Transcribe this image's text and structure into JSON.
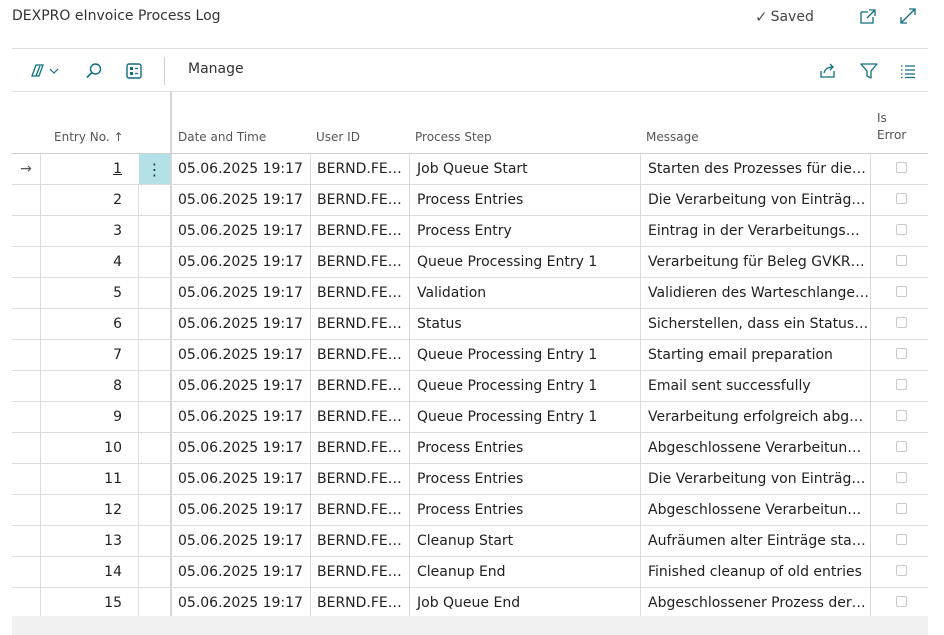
{
  "window": {
    "title": "DEXPRO eInvoice Process Log",
    "saved_label": "Saved",
    "icons": [
      "open-in-new-window-icon",
      "expand-icon"
    ]
  },
  "actionbar": {
    "icons_left": [
      "copilot-icon",
      "chevron-down-icon",
      "search-icon",
      "edit-list-icon"
    ],
    "manage_label": "Manage",
    "icons_right": [
      "share-icon",
      "filter-icon",
      "list-view-icon"
    ]
  },
  "columns": {
    "entry_no": "Entry No.",
    "sort_indicator": "↑",
    "date_time": "Date and Time",
    "user_id": "User ID",
    "process_step": "Process Step",
    "message": "Message",
    "is_error_1": "Is",
    "is_error_2": "Error"
  },
  "rows": [
    {
      "entry": "1",
      "date": "05.06.2025 19:17",
      "user": "BERND.FED...",
      "step": "Job Queue Start",
      "message": "Starten des Prozesses für die e..."
    },
    {
      "entry": "2",
      "date": "05.06.2025 19:17",
      "user": "BERND.FED...",
      "step": "Process Entries",
      "message": "Die Verarbeitung von Einträge..."
    },
    {
      "entry": "3",
      "date": "05.06.2025 19:17",
      "user": "BERND.FED...",
      "step": "Process Entry",
      "message": "Eintrag in der Verarbeitungswa..."
    },
    {
      "entry": "4",
      "date": "05.06.2025 19:17",
      "user": "BERND.FED...",
      "step": "Queue Processing Entry 1",
      "message": "Verarbeitung für Beleg GVKR1..."
    },
    {
      "entry": "5",
      "date": "05.06.2025 19:17",
      "user": "BERND.FED...",
      "step": "Validation",
      "message": "Validieren des Warteschlangen..."
    },
    {
      "entry": "6",
      "date": "05.06.2025 19:17",
      "user": "BERND.FED...",
      "step": "Status",
      "message": "Sicherstellen, dass ein Statusda..."
    },
    {
      "entry": "7",
      "date": "05.06.2025 19:17",
      "user": "BERND.FED...",
      "step": "Queue Processing Entry 1",
      "message": "Starting email preparation"
    },
    {
      "entry": "8",
      "date": "05.06.2025 19:17",
      "user": "BERND.FED...",
      "step": "Queue Processing Entry 1",
      "message": "Email sent successfully"
    },
    {
      "entry": "9",
      "date": "05.06.2025 19:17",
      "user": "BERND.FED...",
      "step": "Queue Processing Entry 1",
      "message": "Verarbeitung erfolgreich abges..."
    },
    {
      "entry": "10",
      "date": "05.06.2025 19:17",
      "user": "BERND.FED...",
      "step": "Process Entries",
      "message": "Abgeschlossene Verarbeitung ..."
    },
    {
      "entry": "11",
      "date": "05.06.2025 19:17",
      "user": "BERND.FED...",
      "step": "Process Entries",
      "message": "Die Verarbeitung von Einträge..."
    },
    {
      "entry": "12",
      "date": "05.06.2025 19:17",
      "user": "BERND.FED...",
      "step": "Process Entries",
      "message": "Abgeschlossene Verarbeitung ..."
    },
    {
      "entry": "13",
      "date": "05.06.2025 19:17",
      "user": "BERND.FED...",
      "step": "Cleanup Start",
      "message": "Aufräumen alter Einträge starten"
    },
    {
      "entry": "14",
      "date": "05.06.2025 19:17",
      "user": "BERND.FED...",
      "step": "Cleanup End",
      "message": "Finished cleanup of old entries"
    },
    {
      "entry": "15",
      "date": "05.06.2025 19:17",
      "user": "BERND.FED...",
      "step": "Job Queue End",
      "message": "Abgeschlossener Prozess der e..."
    }
  ],
  "selected_row_indicator": "→",
  "row_menu_glyph": "⋮",
  "colors": {
    "accent": "#0f6f80",
    "selected_cell": "#b3e1e6"
  }
}
